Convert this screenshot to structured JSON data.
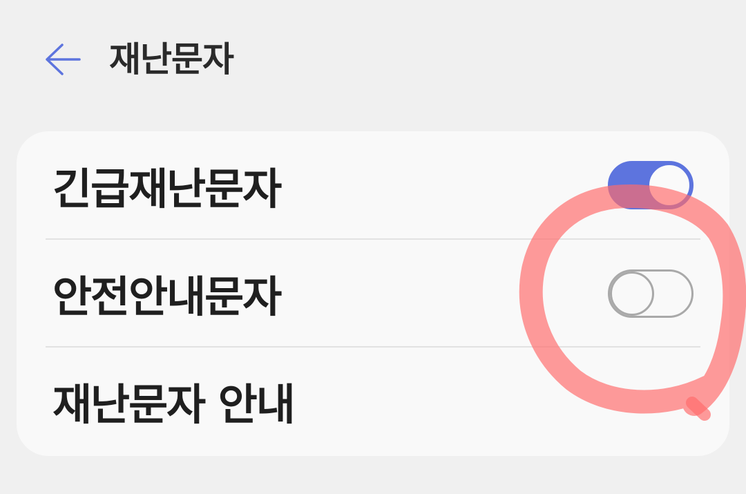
{
  "header": {
    "back_icon": "arrow-left-icon",
    "title": "재난문자"
  },
  "settings": {
    "items": [
      {
        "label": "긴급재난문자",
        "toggle": "on"
      },
      {
        "label": "안전안내문자",
        "toggle": "off"
      },
      {
        "label": "재난문자 안내"
      }
    ]
  },
  "colors": {
    "accent": "#5d74de",
    "background": "#f0f0f0",
    "card": "#f9f9f9",
    "toggle_off": "#a9a9a9",
    "annotation_marker": "#ff6b6b"
  }
}
